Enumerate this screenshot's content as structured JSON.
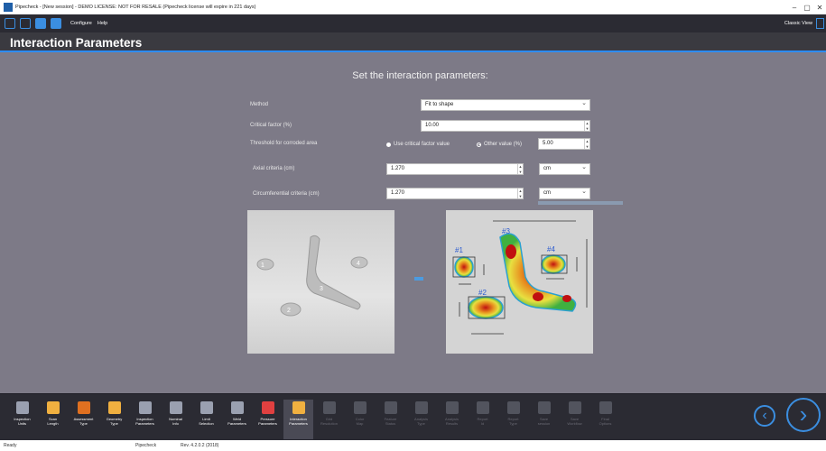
{
  "window": {
    "title": "Pipecheck - [New session] - DEMO LICENSE: NOT FOR RESALE (Pipecheck license will expire in 221 days)",
    "min": "–",
    "max": "▢",
    "close": "✕"
  },
  "menubar": {
    "configure": "Configure",
    "help": "Help",
    "classic_view": "Classic View"
  },
  "header": {
    "title": "Interaction Parameters"
  },
  "main": {
    "subtitle": "Set the interaction parameters:",
    "method_label": "Method",
    "method_value": "Fit to shape",
    "critical_label": "Critical factor (%)",
    "critical_value": "10.00",
    "threshold_label": "Threshold for corroded area",
    "radio_critical": "Use critical factor value",
    "radio_other": "Other value (%)",
    "other_value": "5.00",
    "axial_label": "Axial criteria (cm)",
    "axial_value": "1.270",
    "axial_unit": "cm",
    "circ_label": "Circumferential criteria (cm)",
    "circ_value": "1.270",
    "circ_unit": "cm",
    "left_labels": [
      "1",
      "4",
      "3",
      "2"
    ],
    "right_labels": [
      "#1",
      "#2",
      "#3",
      "#4"
    ]
  },
  "toolbar": [
    {
      "l1": "Inspection",
      "l2": "Units",
      "color": "#9aa0b0",
      "state": "on"
    },
    {
      "l1": "Scan",
      "l2": "Length",
      "color": "#f0b040",
      "state": "on"
    },
    {
      "l1": "Assessment",
      "l2": "Type",
      "color": "#e07020",
      "state": "on"
    },
    {
      "l1": "Geometry",
      "l2": "Type",
      "color": "#f0b040",
      "state": "on"
    },
    {
      "l1": "Inspection",
      "l2": "Parameters",
      "color": "#9aa0b0",
      "state": "on"
    },
    {
      "l1": "Nominal",
      "l2": "Info",
      "color": "#9aa0b0",
      "state": "on"
    },
    {
      "l1": "Limit",
      "l2": "Selection",
      "color": "#9aa0b0",
      "state": "on"
    },
    {
      "l1": "Weld",
      "l2": "Parameters",
      "color": "#9aa0b0",
      "state": "on"
    },
    {
      "l1": "Pressure",
      "l2": "Parameters",
      "color": "#e04040",
      "state": "on"
    },
    {
      "l1": "Interaction",
      "l2": "Parameters",
      "color": "#f0b040",
      "state": "sel"
    },
    {
      "l1": "Grid",
      "l2": "Resolution",
      "color": "#9aa0b0",
      "state": "dis"
    },
    {
      "l1": "Color",
      "l2": "Map",
      "color": "#9aa0b0",
      "state": "dis"
    },
    {
      "l1": "Feature",
      "l2": "Status",
      "color": "#9aa0b0",
      "state": "dis"
    },
    {
      "l1": "Analysis",
      "l2": "Type",
      "color": "#9aa0b0",
      "state": "dis"
    },
    {
      "l1": "Analysis",
      "l2": "Results",
      "color": "#9aa0b0",
      "state": "dis"
    },
    {
      "l1": "Report",
      "l2": "Id",
      "color": "#9aa0b0",
      "state": "dis"
    },
    {
      "l1": "Report",
      "l2": "Type",
      "color": "#9aa0b0",
      "state": "dis"
    },
    {
      "l1": "Save",
      "l2": "session",
      "color": "#9aa0b0",
      "state": "dis"
    },
    {
      "l1": "Save",
      "l2": "Workflow",
      "color": "#9aa0b0",
      "state": "dis"
    },
    {
      "l1": "Final",
      "l2": "Options",
      "color": "#9aa0b0",
      "state": "dis"
    }
  ],
  "nav": {
    "prev": "‹",
    "next": "›"
  },
  "status": {
    "left": "Ready",
    "mid": "Pipecheck",
    "right": "Rev. 4.2.0.2 (2018)"
  },
  "colors": {
    "accent": "#2c8cff",
    "bg": "#7d7a87",
    "bar": "#2b2b33"
  }
}
